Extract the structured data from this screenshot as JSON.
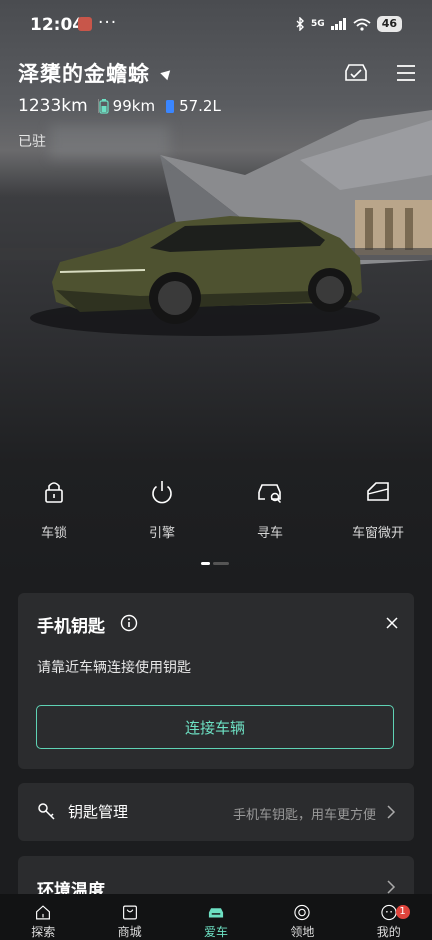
{
  "status_bar": {
    "time": "12:04",
    "dots": "···",
    "network": "5G",
    "battery": "46"
  },
  "header": {
    "car_name": "泽橥的金蟾蜍"
  },
  "stats": {
    "total_range": "1233km",
    "electric_range": "99km",
    "fuel": "57.2L"
  },
  "status_text": "已驻",
  "controls": [
    {
      "label": "车锁",
      "icon": "lock-icon"
    },
    {
      "label": "引擎",
      "icon": "power-icon"
    },
    {
      "label": "寻车",
      "icon": "find-car-icon"
    },
    {
      "label": "车窗微开",
      "icon": "window-icon"
    }
  ],
  "pager": {
    "pages": 2,
    "active": 1
  },
  "phone_key_card": {
    "title": "手机钥匙",
    "description": "请靠近车辆连接使用钥匙",
    "connect_label": "连接车辆"
  },
  "key_management": {
    "label": "钥匙管理",
    "hint": "手机车钥匙，用车更方便"
  },
  "environment": {
    "label": "环境温度"
  },
  "tabs": [
    {
      "label": "探索",
      "icon": "home-icon",
      "active": false
    },
    {
      "label": "商城",
      "icon": "shop-icon",
      "active": false
    },
    {
      "label": "爱车",
      "icon": "car-icon",
      "active": true
    },
    {
      "label": "领地",
      "icon": "community-icon",
      "active": false
    },
    {
      "label": "我的",
      "icon": "profile-icon",
      "active": false,
      "badge": "1"
    }
  ],
  "colors": {
    "accent": "#6de0c3",
    "card": "#2b2c2e",
    "background": "#1c1d1f",
    "badge": "#e0443c"
  }
}
